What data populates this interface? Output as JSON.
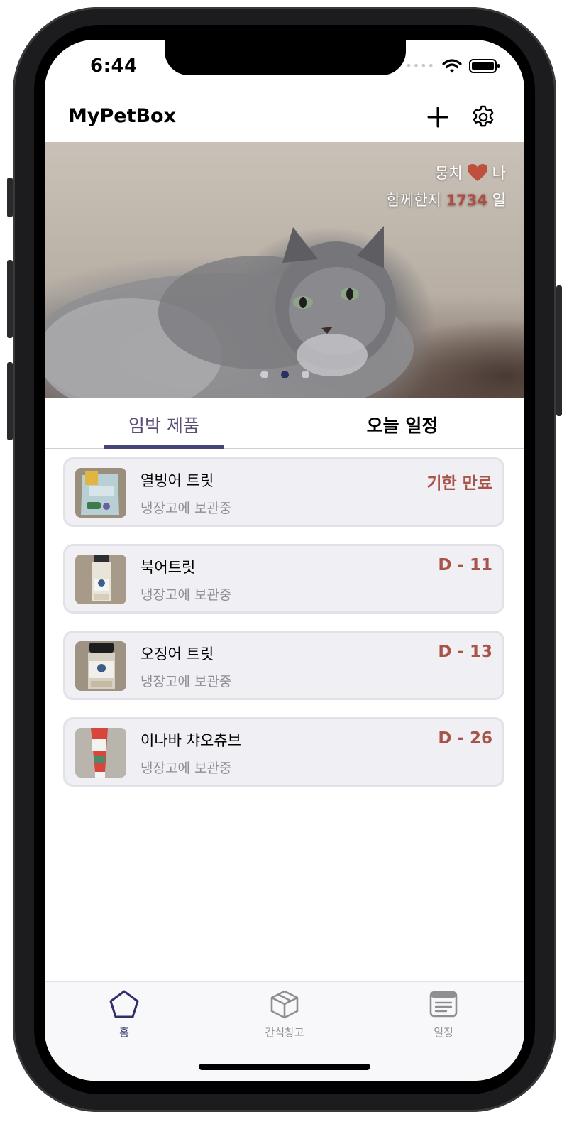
{
  "status_bar": {
    "time": "6:44",
    "signal_dots": "••••"
  },
  "header": {
    "title": "MyPetBox",
    "add_icon": "plus-icon",
    "settings_icon": "gear-icon"
  },
  "banner": {
    "line1_left": "뭉치",
    "line1_right": "나",
    "line2_prefix": "함께한지",
    "days": "1734",
    "line2_suffix": "일",
    "heart_color": "#c0503e",
    "page_count": 3,
    "active_page": 2
  },
  "tabs": [
    {
      "label": "임박 제품",
      "selected": true
    },
    {
      "label": "오늘 일정",
      "selected": false
    }
  ],
  "items": [
    {
      "name": "열빙어 트릿",
      "storage": "냉장고에 보관중",
      "due": "기한 만료"
    },
    {
      "name": "북어트릿",
      "storage": "냉장고에 보관중",
      "due": "D - 11"
    },
    {
      "name": "오징어 트릿",
      "storage": "냉장고에 보관중",
      "due": "D - 13"
    },
    {
      "name": "이나바 챠오츄브",
      "storage": "냉장고에 보관중",
      "due": "D - 26"
    }
  ],
  "tabbar": [
    {
      "label": "홈",
      "icon": "pentagon-icon",
      "selected": true
    },
    {
      "label": "간식창고",
      "icon": "box-icon",
      "selected": false
    },
    {
      "label": "일정",
      "icon": "calendar-icon",
      "selected": false
    }
  ],
  "colors": {
    "accent": "#45457a",
    "due_text": "#a9544a",
    "card_bg": "#f0eff4"
  }
}
